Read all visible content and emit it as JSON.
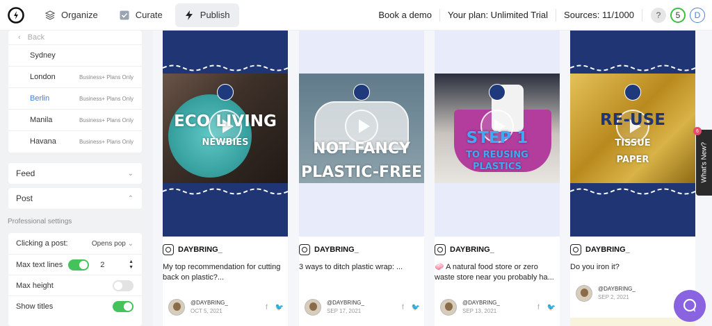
{
  "header": {
    "tabs": [
      {
        "label": "Organize",
        "icon": "layers-icon"
      },
      {
        "label": "Curate",
        "icon": "checkbox-icon"
      },
      {
        "label": "Publish",
        "icon": "lightning-icon"
      }
    ],
    "book_demo": "Book a demo",
    "plan": "Your plan: Unlimited Trial",
    "sources": "Sources: 11/1000",
    "help": "?",
    "count": "5",
    "avatar": "D"
  },
  "sidebar": {
    "back": "Back",
    "cities": [
      {
        "name": "Sydney",
        "tag": ""
      },
      {
        "name": "London",
        "tag": "Business+ Plans Only"
      },
      {
        "name": "Berlin",
        "tag": "Business+ Plans Only"
      },
      {
        "name": "Manila",
        "tag": "Business+ Plans Only"
      },
      {
        "name": "Havana",
        "tag": "Business+ Plans Only"
      }
    ],
    "feed": "Feed",
    "post": "Post",
    "professional": "Professional settings",
    "clicking_label": "Clicking a post:",
    "clicking_value": "Opens pop",
    "max_text_lines": "Max text lines",
    "max_text_lines_value": "2",
    "max_height": "Max height",
    "show_titles": "Show titles"
  },
  "cards": [
    {
      "overlay1": "ECO LIVING",
      "overlay2": "NEWBIES",
      "handle": "DAYBRING_",
      "caption": "My top recommendation for cutting back on plastic?...",
      "author": "@DAYBRING_",
      "date": "OCT 5, 2021"
    },
    {
      "overlay1": "NOT FANCY",
      "overlay2": "PLASTIC-FREE",
      "handle": "DAYBRING_",
      "caption": "3 ways to ditch plastic wrap: ...",
      "author": "@DAYBRING_",
      "date": "SEP 17, 2021"
    },
    {
      "overlay1": "STEP 1",
      "overlay2": "TO REUSING",
      "overlay3": "PLASTICS",
      "handle": "DAYBRING_",
      "caption": "🧼 A natural food store or zero waste store near you probably ha...",
      "author": "@DAYBRING_",
      "date": "SEP 13, 2021"
    },
    {
      "overlay1": "RE-USE",
      "overlay2": "TISSUE",
      "overlay3": "PAPER",
      "handle": "DAYBRING_",
      "caption": "Do you iron it?",
      "author": "@DAYBRING_",
      "date": "SEP 2, 2021"
    }
  ],
  "whats_new": "What's New?",
  "whats_new_count": "6",
  "colors": {
    "navy": "#1f3574",
    "pale_blue": "#e7ebfa",
    "accent_green": "#44c35c",
    "accent_blue": "#3d7fd9",
    "chat_purple": "#8a63e0"
  }
}
